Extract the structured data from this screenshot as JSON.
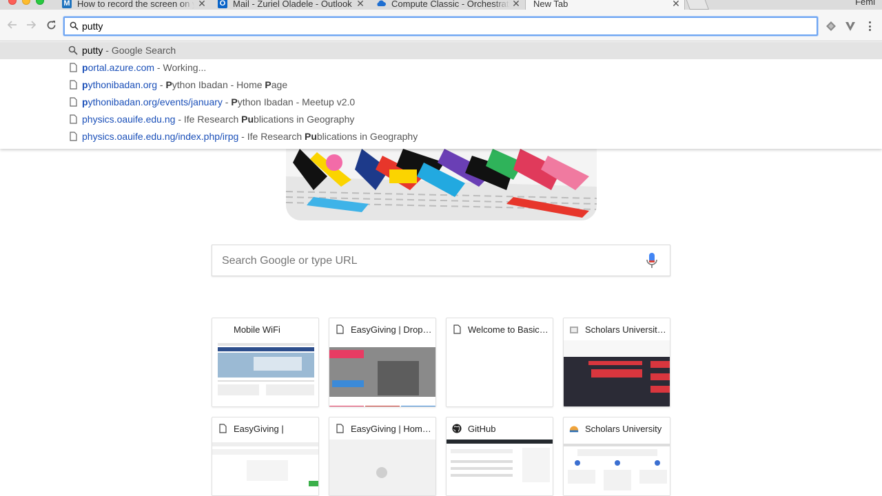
{
  "browser": {
    "tabs": [
      {
        "title": "How to record the screen on y",
        "favicon": "medium-icon",
        "active": false
      },
      {
        "title": "Mail - Zuriel Oladele - Outlook",
        "favicon": "outlook-icon",
        "active": false
      },
      {
        "title": "Compute Classic - Orchestrati",
        "favicon": "cloud-icon",
        "active": false
      },
      {
        "title": "New Tab",
        "favicon": "",
        "active": true
      }
    ],
    "profile_name": "Femi",
    "colors": {
      "focus_ring": "#6ea5f2",
      "link": "#1a4fb8",
      "selected_row": "#e3e3e3"
    }
  },
  "omnibox": {
    "value": "putty",
    "suggestions": [
      {
        "icon": "search-icon",
        "query": "putty",
        "separator": " - ",
        "desc": "Google Search"
      },
      {
        "icon": "page-icon",
        "url_match": "p",
        "url_rest": "ortal.azure.com",
        "separator": " - ",
        "desc_pre": "",
        "desc_match": "",
        "desc_post": "Working..."
      },
      {
        "icon": "page-icon",
        "url_match": "p",
        "url_rest": "ythonibadan.org",
        "separator": " - ",
        "desc_pre": "",
        "desc_match": "P",
        "desc_post": "ython Ibadan - Home ",
        "desc_match2": "P",
        "desc_post2": "age"
      },
      {
        "icon": "page-icon",
        "url_match": "p",
        "url_rest": "ythonibadan.org/events/january",
        "separator": " - ",
        "desc_pre": "",
        "desc_match": "P",
        "desc_post": "ython Ibadan - Meetup v2.0"
      },
      {
        "icon": "page-icon",
        "url_match": "",
        "url_rest": "physics.oauife.edu.ng",
        "separator": " - ",
        "desc_pre": "Ife Research ",
        "desc_match": "Pu",
        "desc_post": "blications in Geography"
      },
      {
        "icon": "page-icon",
        "url_match": "",
        "url_rest": "physics.oauife.edu.ng/index.php/irpg",
        "separator": " - ",
        "desc_pre": "Ife Research ",
        "desc_match": "Pu",
        "desc_post": "blications in Geography"
      }
    ]
  },
  "newtab": {
    "search_placeholder": "Search Google or type URL",
    "tiles": [
      {
        "title": "Mobile WiFi",
        "favicon": ""
      },
      {
        "title": "EasyGiving | Drops of Kindness",
        "favicon": "page-icon"
      },
      {
        "title": "Welcome to Basic Tutorials",
        "favicon": "page-icon"
      },
      {
        "title": "Scholars University: Home",
        "favicon": "scholars-icon"
      },
      {
        "title": "EasyGiving |",
        "favicon": "page-icon"
      },
      {
        "title": "EasyGiving | Home Page",
        "favicon": "page-icon"
      },
      {
        "title": "GitHub",
        "favicon": "github-icon"
      },
      {
        "title": "Scholars University",
        "favicon": "scholars-icon"
      }
    ]
  }
}
